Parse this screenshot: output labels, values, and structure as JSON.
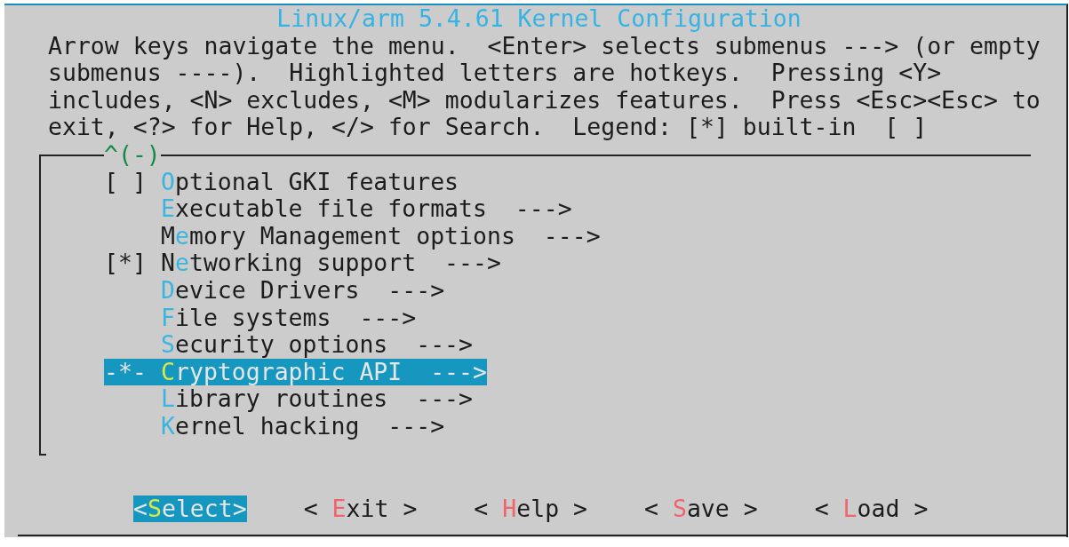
{
  "window": {
    "title": "Linux/arm 5.4.61 Kernel Configuration"
  },
  "description_lines": [
    "Arrow keys navigate the menu.  <Enter> selects submenus ---> (or empty",
    "submenus ----).  Highlighted letters are hotkeys.  Pressing <Y>",
    "includes, <N> excludes, <M> modularizes features.  Press <Esc><Esc> to",
    "exit, <?> for Help, </> for Search.  Legend: [*] built-in  [ ]"
  ],
  "menu": {
    "scroll_indicator": "^(-)",
    "items": [
      {
        "marker": "[ ]",
        "hotkey": "O",
        "after": "ptional GKI features",
        "selected": false
      },
      {
        "marker": "",
        "hotkey": "E",
        "after": "xecutable file formats",
        "arrow": "--->",
        "selected": false
      },
      {
        "marker": "",
        "before": "M",
        "hotkey": "e",
        "after": "mory Management options",
        "arrow": "--->",
        "selected": false
      },
      {
        "marker": "[*]",
        "before": "N",
        "hotkey": "e",
        "after": "tworking support",
        "arrow": "--->",
        "selected": false
      },
      {
        "marker": "",
        "hotkey": "D",
        "after": "evice Drivers",
        "arrow": "--->",
        "selected": false
      },
      {
        "marker": "",
        "hotkey": "F",
        "after": "ile systems",
        "arrow": "--->",
        "selected": false
      },
      {
        "marker": "",
        "hotkey": "S",
        "after": "ecurity options",
        "arrow": "--->",
        "selected": false
      },
      {
        "marker": "-*-",
        "hotkey": "C",
        "after": "ryptographic API",
        "arrow": "--->",
        "selected": true
      },
      {
        "marker": "",
        "hotkey": "L",
        "after": "ibrary routines",
        "arrow": "--->",
        "selected": false
      },
      {
        "marker": "",
        "hotkey": "K",
        "after": "ernel hacking",
        "arrow": "--->",
        "selected": false
      }
    ]
  },
  "buttons": [
    {
      "open": "<",
      "hotkey": "S",
      "rest": "elect",
      "close": ">",
      "selected": true
    },
    {
      "open": "< ",
      "hotkey": "E",
      "rest": "xit",
      "close": " >",
      "selected": false
    },
    {
      "open": "< ",
      "hotkey": "H",
      "rest": "elp",
      "close": " >",
      "selected": false
    },
    {
      "open": "< ",
      "hotkey": "S",
      "rest": "ave",
      "close": " >",
      "selected": false
    },
    {
      "open": "< ",
      "hotkey": "L",
      "rest": "oad",
      "close": " >",
      "selected": false
    }
  ]
}
